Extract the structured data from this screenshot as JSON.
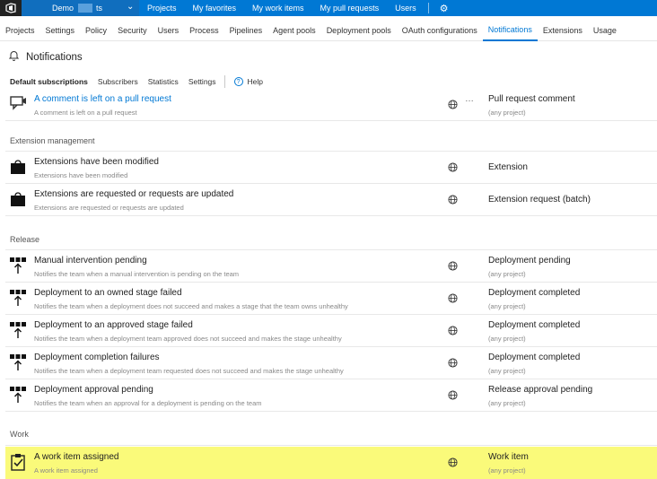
{
  "topbar": {
    "account": "Demo          ts",
    "items": [
      "Projects",
      "My favorites",
      "My work items",
      "My pull requests",
      "Users"
    ]
  },
  "subnav": {
    "tabs": [
      "Projects",
      "Settings",
      "Policy",
      "Security",
      "Users",
      "Process",
      "Pipelines",
      "Agent pools",
      "Deployment pools",
      "OAuth configurations",
      "Notifications",
      "Extensions",
      "Usage"
    ],
    "active": "Notifications"
  },
  "page": {
    "title": "Notifications",
    "subtabs": [
      "Default subscriptions",
      "Subscribers",
      "Statistics",
      "Settings"
    ],
    "help": "Help"
  },
  "partial_row": {
    "title": "A comment is left on a pull request",
    "desc": "A comment is left on a pull request",
    "type": "Pull request comment",
    "scope": "(any project)",
    "more": "…"
  },
  "sections": {
    "extension": {
      "label": "Extension management",
      "rows": [
        {
          "title": "Extensions have been modified",
          "desc": "Extensions have been modified",
          "type": "Extension"
        },
        {
          "title": "Extensions are requested or requests are updated",
          "desc": "Extensions are requested or requests are updated",
          "type": "Extension request (batch)"
        }
      ]
    },
    "release": {
      "label": "Release",
      "rows": [
        {
          "title": "Manual intervention pending",
          "desc": "Notifies the team when a manual intervention is pending on the team",
          "type": "Deployment pending",
          "scope": "(any project)"
        },
        {
          "title": "Deployment to an owned stage failed",
          "desc": "Notifies the team when a deployment does not succeed and makes a stage that the team owns unhealthy",
          "type": "Deployment completed",
          "scope": "(any project)"
        },
        {
          "title": "Deployment to an approved stage failed",
          "desc": "Notifies the team when a deployment team approved does not succeed and makes the stage unhealthy",
          "type": "Deployment completed",
          "scope": "(any project)"
        },
        {
          "title": "Deployment completion failures",
          "desc": "Notifies the team when a deployment team requested does not succeed and makes the stage unhealthy",
          "type": "Deployment completed",
          "scope": "(any project)"
        },
        {
          "title": "Deployment approval pending",
          "desc": "Notifies the team when an approval for a deployment is pending on the team",
          "type": "Release approval pending",
          "scope": "(any project)"
        }
      ]
    },
    "work": {
      "label": "Work",
      "rows": [
        {
          "title": "A work item assigned",
          "desc": "A work item assigned",
          "type": "Work item",
          "scope": "(any project)"
        }
      ]
    }
  },
  "colors": {
    "accent": "#0078d4",
    "highlight": "#fafa7a",
    "topbar_bg": "#0078d4"
  }
}
